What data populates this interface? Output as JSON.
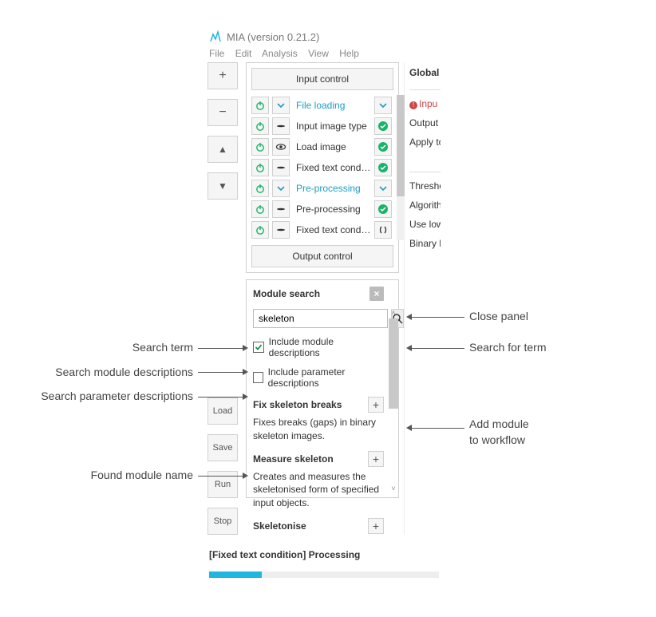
{
  "app": {
    "title": "MIA (version 0.21.2)",
    "menu": [
      "File",
      "Edit",
      "Analysis",
      "View",
      "Help"
    ]
  },
  "left_toolbar": {
    "plus": "+",
    "minus": "−",
    "up": "▲",
    "down": "▼",
    "load": "Load",
    "save": "Save",
    "run": "Run",
    "stop": "Stop"
  },
  "workspace": {
    "input_control_btn": "Input control",
    "output_control_btn": "Output control",
    "modules": [
      {
        "name": "File loading",
        "is_category": true,
        "icon2": "chev-down",
        "status": "chev-down"
      },
      {
        "name": "Input image type",
        "is_category": false,
        "icon2": "dash",
        "status": "ok"
      },
      {
        "name": "Load image",
        "is_category": false,
        "icon2": "eye",
        "status": "ok"
      },
      {
        "name": "Fixed text condition",
        "is_category": false,
        "icon2": "dash",
        "status": "ok"
      },
      {
        "name": "Pre-processing",
        "is_category": true,
        "icon2": "chev-down",
        "status": "chev-down"
      },
      {
        "name": "Pre-processing",
        "is_category": false,
        "icon2": "dash",
        "status": "ok"
      },
      {
        "name": "Fixed text condition",
        "is_category": false,
        "icon2": "dash",
        "status": "brackets",
        "selected": true
      }
    ]
  },
  "search": {
    "title": "Module search",
    "term": "skeleton",
    "include_module_desc_label": "Include module descriptions",
    "include_module_desc_checked": true,
    "include_param_desc_label": "Include parameter descriptions",
    "include_param_desc_checked": false,
    "results": [
      {
        "title": "Fix skeleton breaks",
        "desc": "Fixes breaks (gaps) in binary skeleton images."
      },
      {
        "title": "Measure skeleton",
        "desc": "Creates and measures the skeletonised form of specified input objects."
      },
      {
        "title": "Skeletonise",
        "desc": ""
      }
    ]
  },
  "right_panel": {
    "header": "Global a",
    "input_warn": "Inpu",
    "output_line": "Output i",
    "apply_line": "Apply to",
    "threshold_line": "Thresho",
    "algorithm_line": "Algorith",
    "use_low_line": "Use low",
    "binary_line": "Binary lo"
  },
  "status_bar": {
    "text": "[Fixed text condition] Processing",
    "progress_pct": 23
  },
  "annotations": {
    "search_term": "Search term",
    "search_module_desc": "Search module descriptions",
    "search_param_desc": "Search parameter descriptions",
    "found_module": "Found module name",
    "close_panel": "Close panel",
    "search_for_term": "Search for term",
    "add_module": "Add module\nto workflow"
  }
}
